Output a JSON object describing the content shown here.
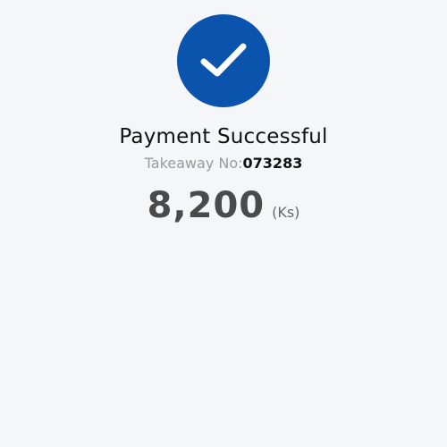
{
  "status": {
    "title": "Payment Successful",
    "icon": "checkmark-icon",
    "accent_color": "#0b54ae"
  },
  "order": {
    "label": "Takeaway No:",
    "number": "073283"
  },
  "amount": {
    "value": "8,200",
    "currency": "(Ks)"
  }
}
